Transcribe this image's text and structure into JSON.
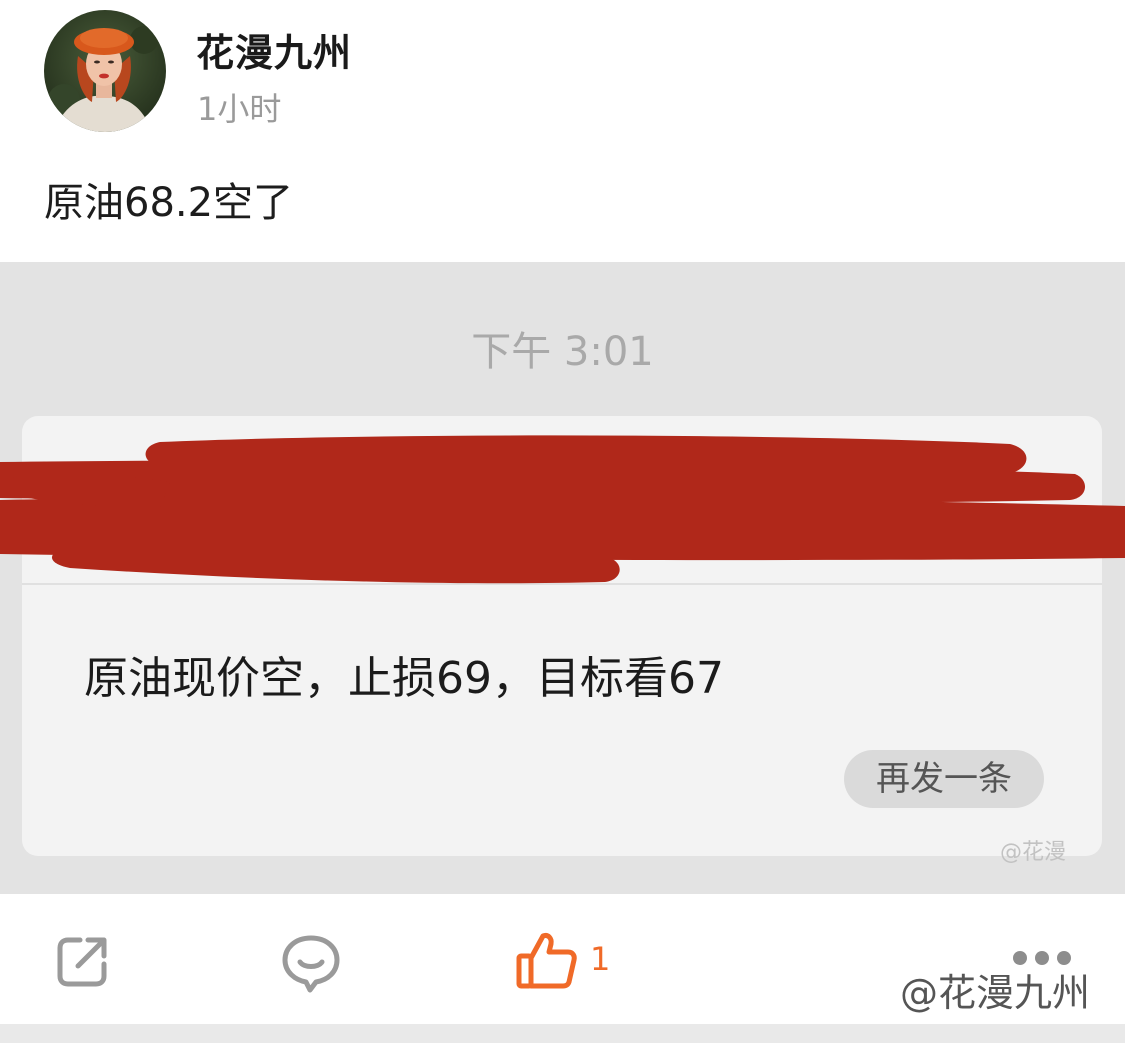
{
  "post": {
    "username": "花漫九州",
    "time_ago": "1小时",
    "text": "原油68.2空了"
  },
  "embed": {
    "chat_time": "下午 3:01",
    "message": "原油现价空，止损69，目标看67",
    "resend_label": "再发一条",
    "watermark": "@花漫"
  },
  "actions": {
    "like_count": "1"
  },
  "watermark": "@花漫九州",
  "icons": {
    "share": "share-icon",
    "comment": "comment-icon",
    "like": "thumbs-up-icon",
    "more": "more-dots-icon"
  },
  "colors": {
    "accent": "#f06a28",
    "redaction": "#b0281a",
    "embed_bg": "#e3e3e3"
  }
}
